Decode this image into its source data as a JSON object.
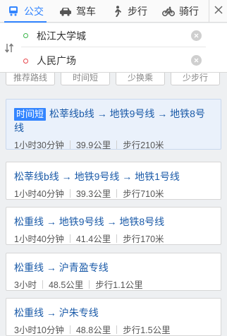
{
  "modes": [
    {
      "label": "公交",
      "icon": "bus-icon",
      "active": true
    },
    {
      "label": "驾车",
      "icon": "car-icon",
      "active": false
    },
    {
      "label": "步行",
      "icon": "walk-icon",
      "active": false
    },
    {
      "label": "骑行",
      "icon": "bike-icon",
      "active": false
    }
  ],
  "route": {
    "start": "松江大学城",
    "end": "人民广场"
  },
  "strategies": [
    "推荐路线",
    "时间短",
    "少换乘",
    "少步行"
  ],
  "results": [
    {
      "badge": "时间短",
      "line": "松莘线b线 → 地铁9号线 → 地铁8号线",
      "duration": "1小时30分钟",
      "distance": "39.9公里",
      "walk": "步行210米"
    },
    {
      "badge": "",
      "line": "松莘线b线 → 地铁9号线 → 地铁1号线",
      "duration": "1小时40分钟",
      "distance": "39.3公里",
      "walk": "步行710米"
    },
    {
      "badge": "",
      "line": "松重线 → 地铁9号线 → 地铁8号线",
      "duration": "1小时40分钟",
      "distance": "41.4公里",
      "walk": "步行170米"
    },
    {
      "badge": "",
      "line": "松重线 → 沪青盈专线",
      "duration": "3小时",
      "distance": "48.5公里",
      "walk": "步行1.1公里"
    },
    {
      "badge": "",
      "line": "松重线 → 沪朱专线",
      "duration": "3小时10分钟",
      "distance": "48.8公里",
      "walk": "步行1.5公里"
    }
  ],
  "colors": {
    "accent": "#3385ff",
    "link": "#1a5aa8",
    "start_dot": "#3ab54a",
    "end_dot": "#e8464b"
  }
}
